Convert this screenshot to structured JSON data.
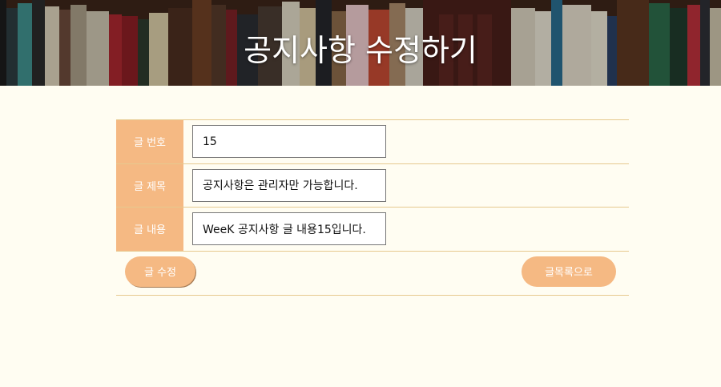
{
  "header": {
    "title": "공지사항 수정하기"
  },
  "form": {
    "rows": [
      {
        "label": "글 번호",
        "value": "15"
      },
      {
        "label": "글 제목",
        "value": "공지사항은 관리자만 가능합니다."
      },
      {
        "label": "글 내용",
        "value": "WeeK 공지사항 글 내용15입니다."
      }
    ],
    "edit_button": "글 수정",
    "list_button": "글목록으로"
  },
  "colors": {
    "page_bg": "#fffdf2",
    "accent": "#f5b983",
    "border": "#e6c98f"
  }
}
